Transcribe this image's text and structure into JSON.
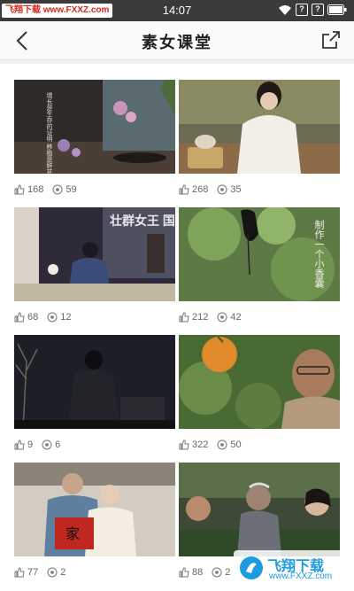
{
  "status_bar": {
    "watermark": "飞翔下载 www.FXXZ.com",
    "time": "14:07",
    "battery_icon": "battery-icon",
    "wifi_icon": "wifi-icon"
  },
  "nav": {
    "title": "素女课堂",
    "back_icon": "back-arrow-icon",
    "share_icon": "share-icon"
  },
  "grid": [
    {
      "likes": "168",
      "views": "59",
      "overlay_text": "增长是生存的证明 移植是鲜花的使命 插入剑山"
    },
    {
      "likes": "268",
      "views": "35"
    },
    {
      "likes": "68",
      "views": "12",
      "overlay_text": "壮群女王 国际中"
    },
    {
      "likes": "212",
      "views": "42",
      "overlay_text": "制作一个小香囊"
    },
    {
      "likes": "9",
      "views": "6"
    },
    {
      "likes": "322",
      "views": "50"
    },
    {
      "likes": "77",
      "views": "2",
      "overlay_text": "家"
    },
    {
      "likes": "88",
      "views": "2"
    }
  ],
  "footer_logo": {
    "label": "飞翔下载",
    "url": "www.FXXZ.com"
  },
  "colors": {
    "status_bar_bg": "#3a3a3a",
    "nav_bg": "#fafafa",
    "watermark_red": "#d6281f",
    "logo_blue": "#1e9be0"
  }
}
